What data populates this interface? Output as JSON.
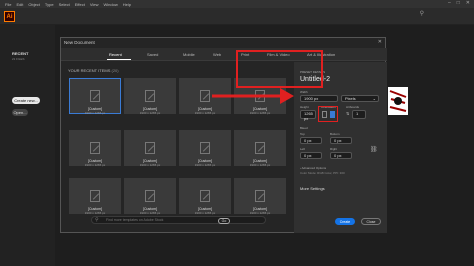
{
  "menu": {
    "items": [
      "File",
      "Edit",
      "Object",
      "Type",
      "Select",
      "Effect",
      "View",
      "Window",
      "Help"
    ],
    "window_controls": [
      "–",
      "□",
      "✕"
    ]
  },
  "app": {
    "logo": "Ai"
  },
  "left_rail": {
    "recent_label": "RECENT",
    "recent_count": "21 FILES",
    "create_new_label": "Create new...",
    "open_label": "Open..."
  },
  "dialog": {
    "title": "New Document",
    "close": "✕",
    "tabs": [
      "Recent",
      "Saved",
      "Mobile",
      "Web",
      "Print",
      "Film & Video",
      "Art & Illustration"
    ],
    "recent_items_label": "YOUR RECENT ITEMS",
    "recent_items_count": "(20)",
    "presets": [
      {
        "name": "[Custom]",
        "size": "1900 x 1265 px"
      },
      {
        "name": "[Custom]",
        "size": "1900 x 1265 px"
      },
      {
        "name": "[Custom]",
        "size": "1900 x 1265 px"
      },
      {
        "name": "[Custom]",
        "size": "1900 x 1265 px"
      },
      {
        "name": "[Custom]",
        "size": "1900 x 1265 px"
      },
      {
        "name": "[Custom]",
        "size": "1900 x 1265 px"
      },
      {
        "name": "[Custom]",
        "size": "1900 x 1265 px"
      },
      {
        "name": "[Custom]",
        "size": "1900 x 1265 px"
      },
      {
        "name": "[Custom]",
        "size": "1900 x 1265 px"
      },
      {
        "name": "[Custom]",
        "size": "1900 x 1265 px"
      },
      {
        "name": "[Custom]",
        "size": "1900 x 1265 px"
      },
      {
        "name": "[Custom]",
        "size": "1900 x 1265 px"
      }
    ],
    "template_search_placeholder": "Find more templates on Adobe Stock",
    "go_label": "Go",
    "details": {
      "section_label": "PRESET DETAILS",
      "document_name": "Untitled-2",
      "width_label": "Width",
      "width_value": "1900 px",
      "units_value": "Pixels",
      "height_label": "Height",
      "height_value": "1265 px",
      "orientation_label": "Orientation",
      "artboards_label": "Artboards",
      "artboards_value": "1",
      "bleed_label": "Bleed",
      "top_label": "Top",
      "top_value": "0 px",
      "bottom_label": "Bottom",
      "bottom_value": "0 px",
      "left_label": "Left",
      "left_value": "0 px",
      "right_label": "Right",
      "right_value": "0 px",
      "advanced_label": "› Advanced Options",
      "color_mode": "Color Mode: RGB Color, PPI: 300",
      "more_settings": "More Settings",
      "create_label": "Create",
      "close_label": "Close"
    }
  },
  "colors": {
    "accent": "#1473e6",
    "highlight_red": "#e02020",
    "ai_orange": "#ff7c00"
  }
}
